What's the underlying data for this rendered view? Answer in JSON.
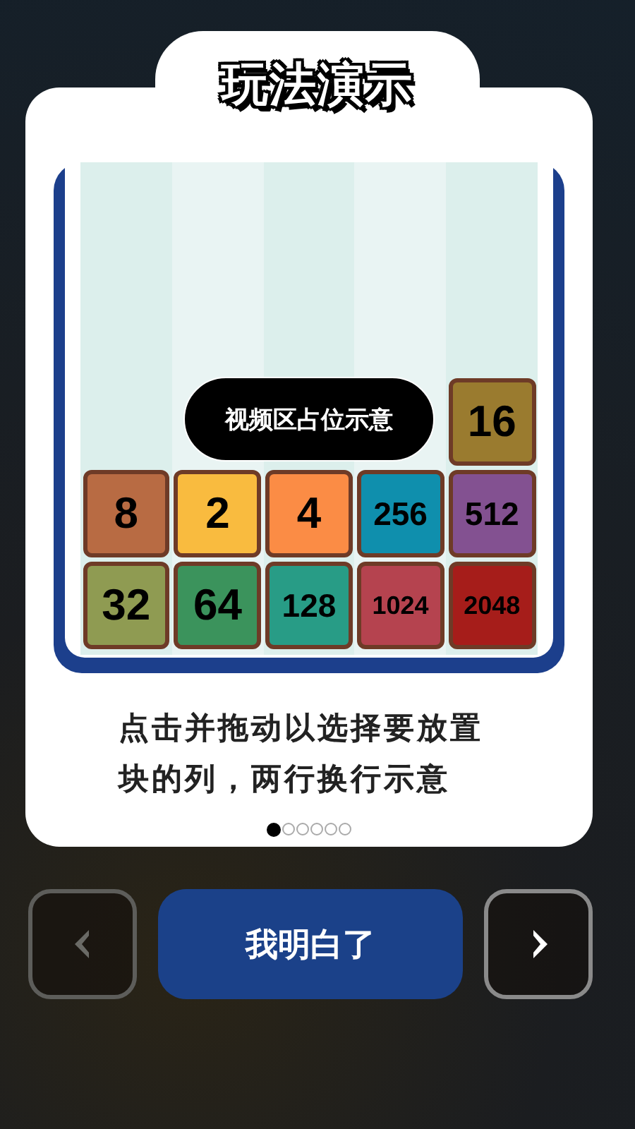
{
  "title": "玩法演示",
  "board": {
    "columns": [
      {
        "tiles": [
          {
            "value": "8",
            "color": "#b86b43"
          },
          {
            "value": "32",
            "color": "#8f9b52"
          }
        ]
      },
      {
        "tiles": [
          {
            "value": "2",
            "color": "#f9bb3f"
          },
          {
            "value": "64",
            "color": "#3b935c"
          }
        ]
      },
      {
        "tiles": [
          {
            "value": "4",
            "color": "#fb8c45"
          },
          {
            "value": "128",
            "color": "#289c86"
          }
        ]
      },
      {
        "tiles": [
          {
            "value": "256",
            "color": "#0f8fad"
          },
          {
            "value": "1024",
            "color": "#b5434f"
          }
        ]
      },
      {
        "tiles": [
          {
            "value": "16",
            "color": "#9a7b2f"
          },
          {
            "value": "512",
            "color": "#835191"
          },
          {
            "value": "2048",
            "color": "#a61d1a"
          }
        ]
      }
    ],
    "overlay": "视频区占位示意"
  },
  "instruction": "点击并拖动以选择要放置块的列，两行换行示意",
  "pager": [
    {
      "selected": true
    },
    {
      "selected": false
    },
    {
      "selected": false
    },
    {
      "selected": false
    },
    {
      "selected": false
    },
    {
      "selected": false
    }
  ],
  "buttons": {
    "previous": {
      "disabled": true
    },
    "confirm": {
      "label": "我明白了"
    },
    "next": {
      "disabled": false
    }
  }
}
